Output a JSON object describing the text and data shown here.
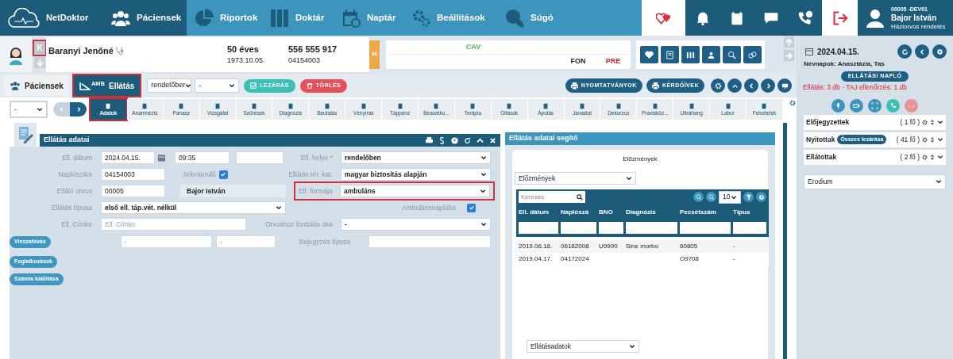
{
  "nav": {
    "brand": "NetDoktor",
    "items": [
      {
        "label": "Páciensek",
        "selected": true
      },
      {
        "label": "Riportok",
        "selected": false
      },
      {
        "label": "Doktár",
        "selected": false
      },
      {
        "label": "Naptár",
        "selected": false
      },
      {
        "label": "Beállítások",
        "selected": false
      },
      {
        "label": "Súgó",
        "selected": false
      }
    ],
    "user": {
      "code": "00005 -DEV01",
      "name": "Bajor István",
      "role": "Háziorvos rendelés"
    }
  },
  "patient": {
    "badge": {
      "label": "K",
      "highlighted": true
    },
    "name": "Baranyi Jenőné",
    "age": "50 éves",
    "birth_date": "1973.10.05.",
    "phone": "556 555 917",
    "id": "04154003",
    "flag": "H",
    "vitals": [
      [
        {
          "kind": "empty"
        },
        {
          "kind": "empty"
        },
        {
          "kind": "value",
          "label": "CAV",
          "color": "#4caf50"
        },
        {
          "kind": "empty"
        },
        {
          "kind": "empty"
        },
        {
          "kind": "empty"
        },
        {
          "kind": "empty"
        }
      ],
      [
        {
          "kind": "empty"
        },
        {
          "kind": "empty"
        },
        {
          "kind": "empty"
        },
        {
          "kind": "empty"
        },
        {
          "kind": "empty"
        },
        {
          "kind": "value",
          "label": "FON",
          "color": "#222222"
        },
        {
          "kind": "value",
          "label": "PRE",
          "color": "#c62828"
        }
      ]
    ]
  },
  "toolbar": {
    "tabs": [
      {
        "label": "Páciensek",
        "selected": false,
        "highlighted": false
      },
      {
        "label": "Ellátás",
        "badge": "AMB",
        "selected": true,
        "highlighted": true
      }
    ],
    "selects": [
      "rendelőber",
      "-"
    ],
    "actions": [
      {
        "label": "LEZÁRÁS",
        "kind": "close"
      },
      {
        "label": "TÖRLÉS",
        "kind": "delete"
      }
    ],
    "right_buttons": [
      "NYOMTATVÁNYOK",
      "KÉRDŐÍVEK"
    ]
  },
  "subnav": {
    "select": "-",
    "tabs": [
      {
        "label": "Adatok",
        "selected": true,
        "highlighted": true
      },
      {
        "label": "Anamnézis",
        "selected": false,
        "highlighted": false
      },
      {
        "label": "Panasz",
        "selected": false,
        "highlighted": false
      },
      {
        "label": "Vizsgálat",
        "selected": false,
        "highlighted": false
      },
      {
        "label": "Szűrések",
        "selected": false,
        "highlighted": false
      },
      {
        "label": "Diagnózis",
        "selected": false,
        "highlighted": false
      },
      {
        "label": "Beutalás",
        "selected": false,
        "highlighted": false
      },
      {
        "label": "Vényírás",
        "selected": false,
        "highlighted": false
      },
      {
        "label": "Táppénz",
        "selected": false,
        "highlighted": false
      },
      {
        "label": "Beavatko...",
        "selected": false,
        "highlighted": false
      },
      {
        "label": "Terápia",
        "selected": false,
        "highlighted": false
      },
      {
        "label": "Oltások",
        "selected": false,
        "highlighted": false
      },
      {
        "label": "Ápolás",
        "selected": false,
        "highlighted": false
      },
      {
        "label": "Javaslat",
        "selected": false,
        "highlighted": false
      },
      {
        "label": "Dekurzus",
        "selected": false,
        "highlighted": false
      },
      {
        "label": "Praxisköz...",
        "selected": false,
        "highlighted": false
      },
      {
        "label": "Ultrahang",
        "selected": false,
        "highlighted": false
      },
      {
        "label": "Labor",
        "selected": false,
        "highlighted": false
      },
      {
        "label": "Felvételek",
        "selected": false,
        "highlighted": false
      }
    ]
  },
  "form": {
    "title": "Ellátás adatai",
    "date": {
      "label": "Ell. dátum",
      "value": "2024.04.15.",
      "time": "09:35"
    },
    "place": {
      "label": "Ell. helye *",
      "value": "rendelőben"
    },
    "log_number": {
      "label": "Naplószám",
      "value": "04154003"
    },
    "reportable": {
      "label": "Jelentendő",
      "checked": true
    },
    "territory": {
      "label": "Ellátás tér. kat.",
      "value": "magyar biztosítás alapján"
    },
    "doctor": {
      "label": "Ellátó orvos",
      "code": "00005",
      "name": "Bajor István"
    },
    "care_form": {
      "label": "Ell. formája",
      "value": "ambuláns",
      "highlighted": true
    },
    "care_type": {
      "label": "Ellátás típusa",
      "value": "első ell. táp.vét. nélkül"
    },
    "ambulance_log": {
      "label": "Ambulánsnaplóba",
      "checked": true
    },
    "tag": {
      "label": "Ell. Címke",
      "placeholder": "Ell. Címke"
    },
    "reason": {
      "label": "Orvoshoz fordulás oka",
      "value": "-"
    },
    "entry": {
      "fields": [
        "-",
        "-"
      ],
      "label": "Bejegyzés típusa"
    },
    "buttons": [
      "Visszahívás",
      "Foglalkozások",
      "Számla kiállítása"
    ]
  },
  "helper": {
    "title": "Ellátás adatai segítő",
    "card_title": "Előzmények",
    "select": "Előzmények",
    "search_placeholder": "Keresés",
    "page_size": "10",
    "table": {
      "columns": [
        "Ell. dátum",
        "Naplószá",
        "BNO",
        "Diagnózis",
        "Pecsétszám",
        "Típus"
      ],
      "rows": [
        [
          "2019.06.18.",
          "06182008",
          "U9990",
          "Sine morbo",
          "60805",
          "-"
        ],
        [
          "2019.04.17.",
          "04172024",
          "",
          "",
          "O9708",
          "-"
        ]
      ]
    },
    "bottom_select": "Ellátásadatok"
  },
  "sidebar": {
    "date": "2024.04.15.",
    "namedays": "Névnapok: Anasztázia, Tas",
    "log_button": "ELLÁTÁSI NAPLÓ",
    "alert": "Ellátás: 3 db - TAJ ellenőrzés: 1 db",
    "lists": [
      {
        "label": "Előjegyzettek",
        "count": "( 1 fő )"
      },
      {
        "label": "Nyitottak",
        "badge": "Összes lezárása",
        "count": "( 41 fő )"
      },
      {
        "label": "Ellátottak",
        "count": "( 2 fő )"
      }
    ],
    "select": "Erodium"
  }
}
